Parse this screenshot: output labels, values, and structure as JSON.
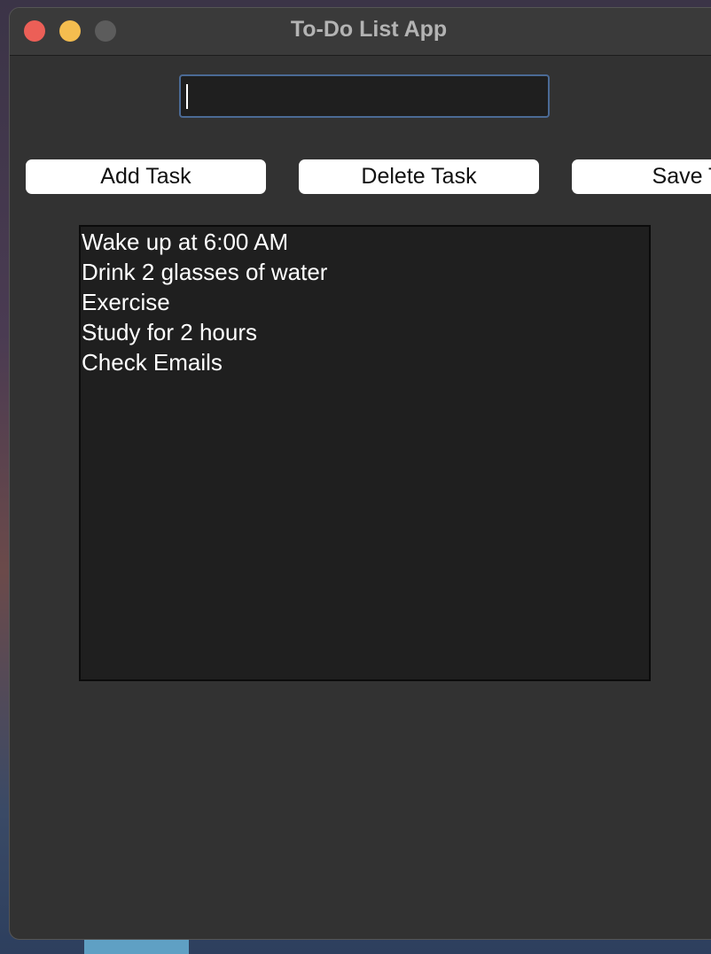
{
  "window": {
    "title": "To-Do List App"
  },
  "input": {
    "value": ""
  },
  "buttons": {
    "add_label": "Add Task",
    "delete_label": "Delete Task",
    "save_label": "Save Ta"
  },
  "tasks": [
    "Wake up at 6:00 AM",
    "Drink 2 glasses of water",
    "Exercise",
    "Study for 2 hours",
    "Check Emails"
  ],
  "colors": {
    "close": "#ec5f57",
    "minimize": "#f4bd4f",
    "maximize": "#5c5c5c",
    "window_bg": "#323232",
    "list_bg": "#1f1f1f",
    "input_border": "#4b6a95"
  },
  "icons": {
    "close": "close-icon",
    "minimize": "minimize-icon",
    "maximize": "maximize-icon"
  }
}
